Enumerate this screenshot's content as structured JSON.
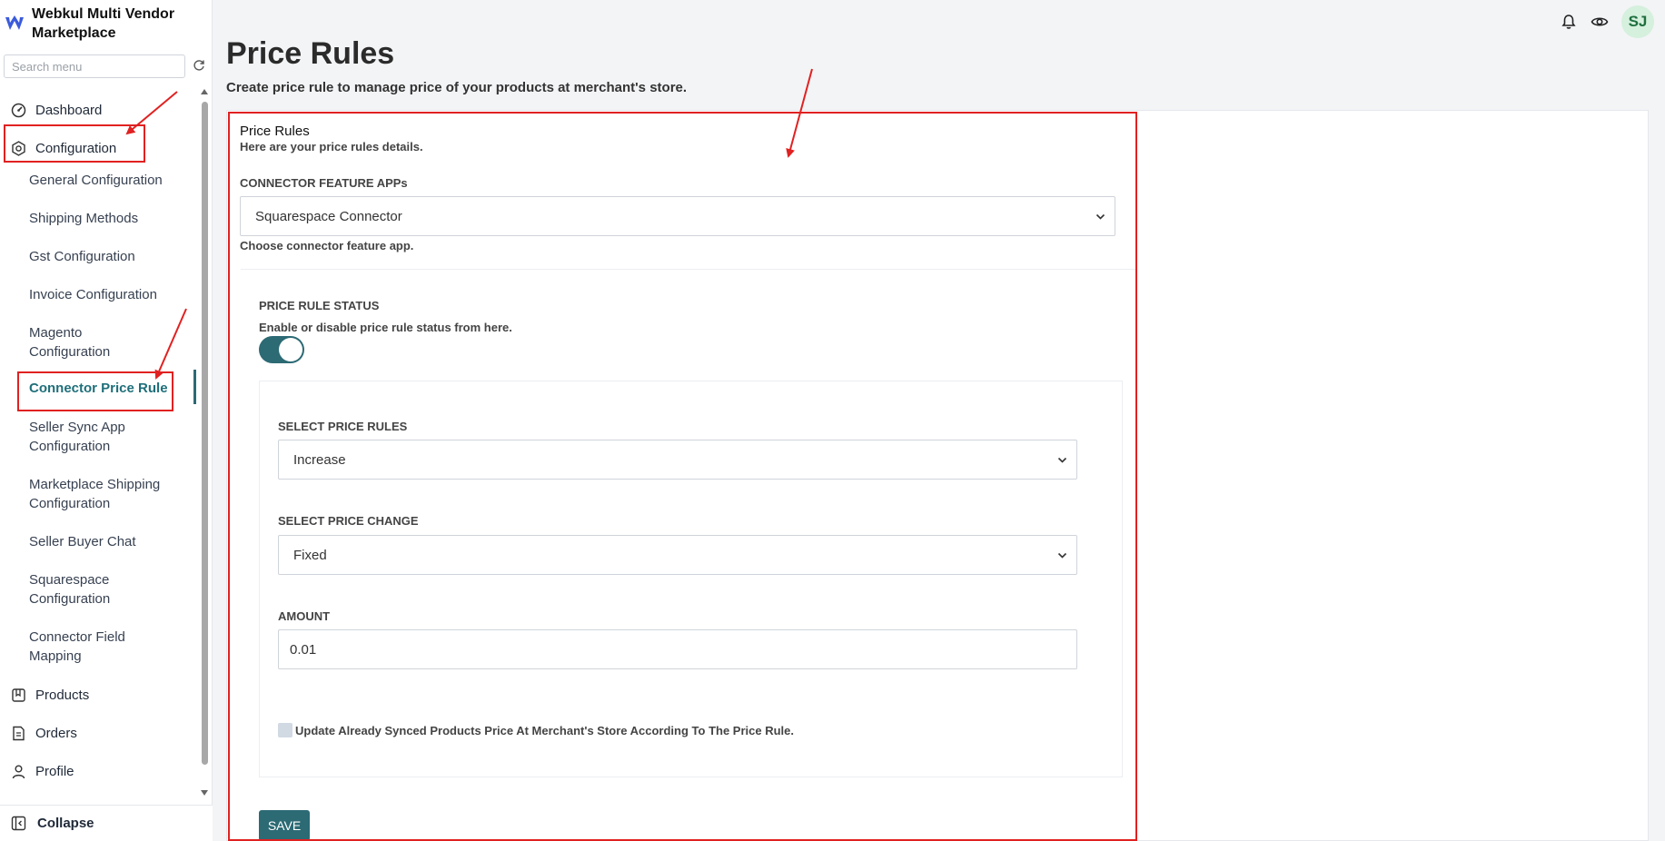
{
  "brand": {
    "name": "Webkul Multi Vendor Marketplace"
  },
  "sidebar": {
    "search_placeholder": "Search menu",
    "items": [
      {
        "label": "Dashboard",
        "icon": "dashboard-icon"
      },
      {
        "label": "Configuration",
        "icon": "config-icon"
      }
    ],
    "subitems": [
      "General Configuration",
      "Shipping Methods",
      "Gst Configuration",
      "Invoice Configuration",
      "Magento Configuration",
      "Connector Price Rule",
      "Seller Sync App Configuration",
      "Marketplace Shipping Configuration",
      "Seller Buyer Chat",
      "Squarespace Configuration",
      "Connector Field Mapping"
    ],
    "bottom_items": [
      {
        "label": "Products",
        "icon": "products-icon"
      },
      {
        "label": "Orders",
        "icon": "orders-icon"
      },
      {
        "label": "Profile",
        "icon": "profile-icon"
      }
    ],
    "collapse_label": "Collapse",
    "active_subitem": "Connector Price Rule"
  },
  "topbar": {
    "avatar_initials": "SJ"
  },
  "page": {
    "title": "Price Rules",
    "subtitle": "Create price rule to manage price of your products at merchant's store."
  },
  "form": {
    "section_title": "Price Rules",
    "section_subtitle": "Here are your price rules details.",
    "connector_label": "CONNECTOR FEATURE APPs",
    "connector_value": "Squarespace Connector",
    "connector_help": "Choose connector feature app.",
    "status_label": "PRICE RULE STATUS",
    "status_help": "Enable or disable price rule status from here.",
    "status_enabled": true,
    "price_rules_label": "SELECT PRICE RULES",
    "price_rules_value": "Increase",
    "price_change_label": "SELECT PRICE CHANGE",
    "price_change_value": "Fixed",
    "amount_label": "AMOUNT",
    "amount_value": "0.01",
    "update_checkbox_label": "Update Already Synced Products Price At Merchant's Store According To The Price Rule.",
    "save_label": "SAVE"
  },
  "colors": {
    "accent": "#2c6a74",
    "annotation": "#e12121"
  }
}
